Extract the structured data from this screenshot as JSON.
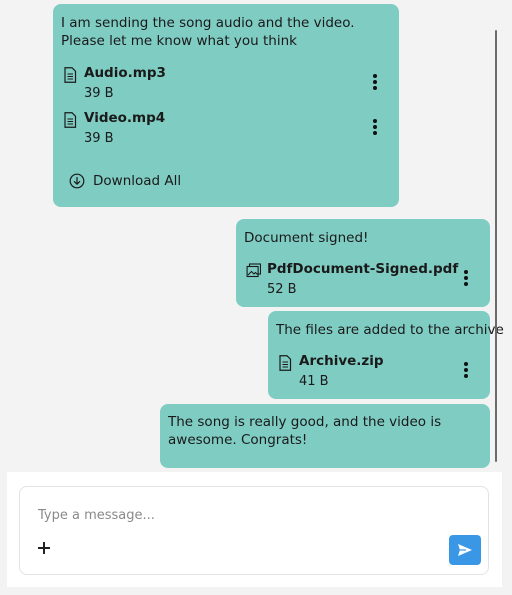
{
  "messages": [
    {
      "text": "I am sending the song audio and the video. Please let me know what you think",
      "attachments": [
        {
          "name": "Audio.mp3",
          "size": "39 B",
          "icon": "document-icon"
        },
        {
          "name": "Video.mp4",
          "size": "39 B",
          "icon": "document-icon"
        }
      ],
      "download_all_label": "Download All"
    },
    {
      "text": "Document signed!",
      "attachments": [
        {
          "name": "PdfDocument-Signed.pdf",
          "size": "52 B",
          "icon": "image-document-icon"
        }
      ]
    },
    {
      "text": "The files are added to the archive",
      "attachments": [
        {
          "name": "Archive.zip",
          "size": "41 B",
          "icon": "document-icon"
        }
      ]
    },
    {
      "text": "The song is really good, and the video is awesome. Congrats!",
      "attachments": []
    }
  ],
  "composer": {
    "placeholder": "Type a message...",
    "value": ""
  },
  "colors": {
    "bubble": "#7fccc3",
    "send_button": "#3a97e6",
    "background": "#f3f3f3"
  }
}
